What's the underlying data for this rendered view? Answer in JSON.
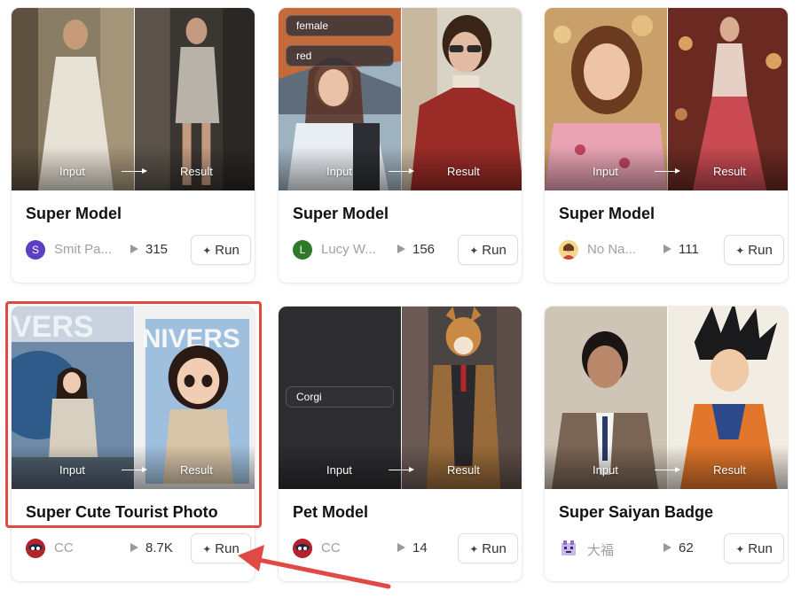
{
  "labels": {
    "input": "Input",
    "result": "Result",
    "run": "Run"
  },
  "cards": [
    {
      "title": "Super Model",
      "author": "Smit Pa...",
      "avatar_letter": "S",
      "avatar_color": "#5b3fc4",
      "plays": "315",
      "tags": []
    },
    {
      "title": "Super Model",
      "author": "Lucy W...",
      "avatar_letter": "L",
      "avatar_color": "#2f7a2a",
      "plays": "156",
      "tags": [
        "female",
        "red"
      ]
    },
    {
      "title": "Super Model",
      "author": "No Na...",
      "avatar_letter": "",
      "avatar_color": "#e8c04a",
      "plays": "111",
      "tags": []
    },
    {
      "title": "Super Cute Tourist Photo",
      "author": "CC",
      "avatar_letter": "",
      "avatar_color": "#c0262b",
      "plays": "8.7K",
      "tags": []
    },
    {
      "title": "Pet Model",
      "author": "CC",
      "avatar_letter": "",
      "avatar_color": "#c0262b",
      "plays": "14",
      "tags": [
        "Corgi"
      ]
    },
    {
      "title": "Super Saiyan Badge",
      "author": "大福",
      "avatar_letter": "",
      "avatar_color": "#8f6fc9",
      "plays": "62",
      "tags": []
    }
  ],
  "annotation": {
    "highlight_color": "#e04a44"
  }
}
